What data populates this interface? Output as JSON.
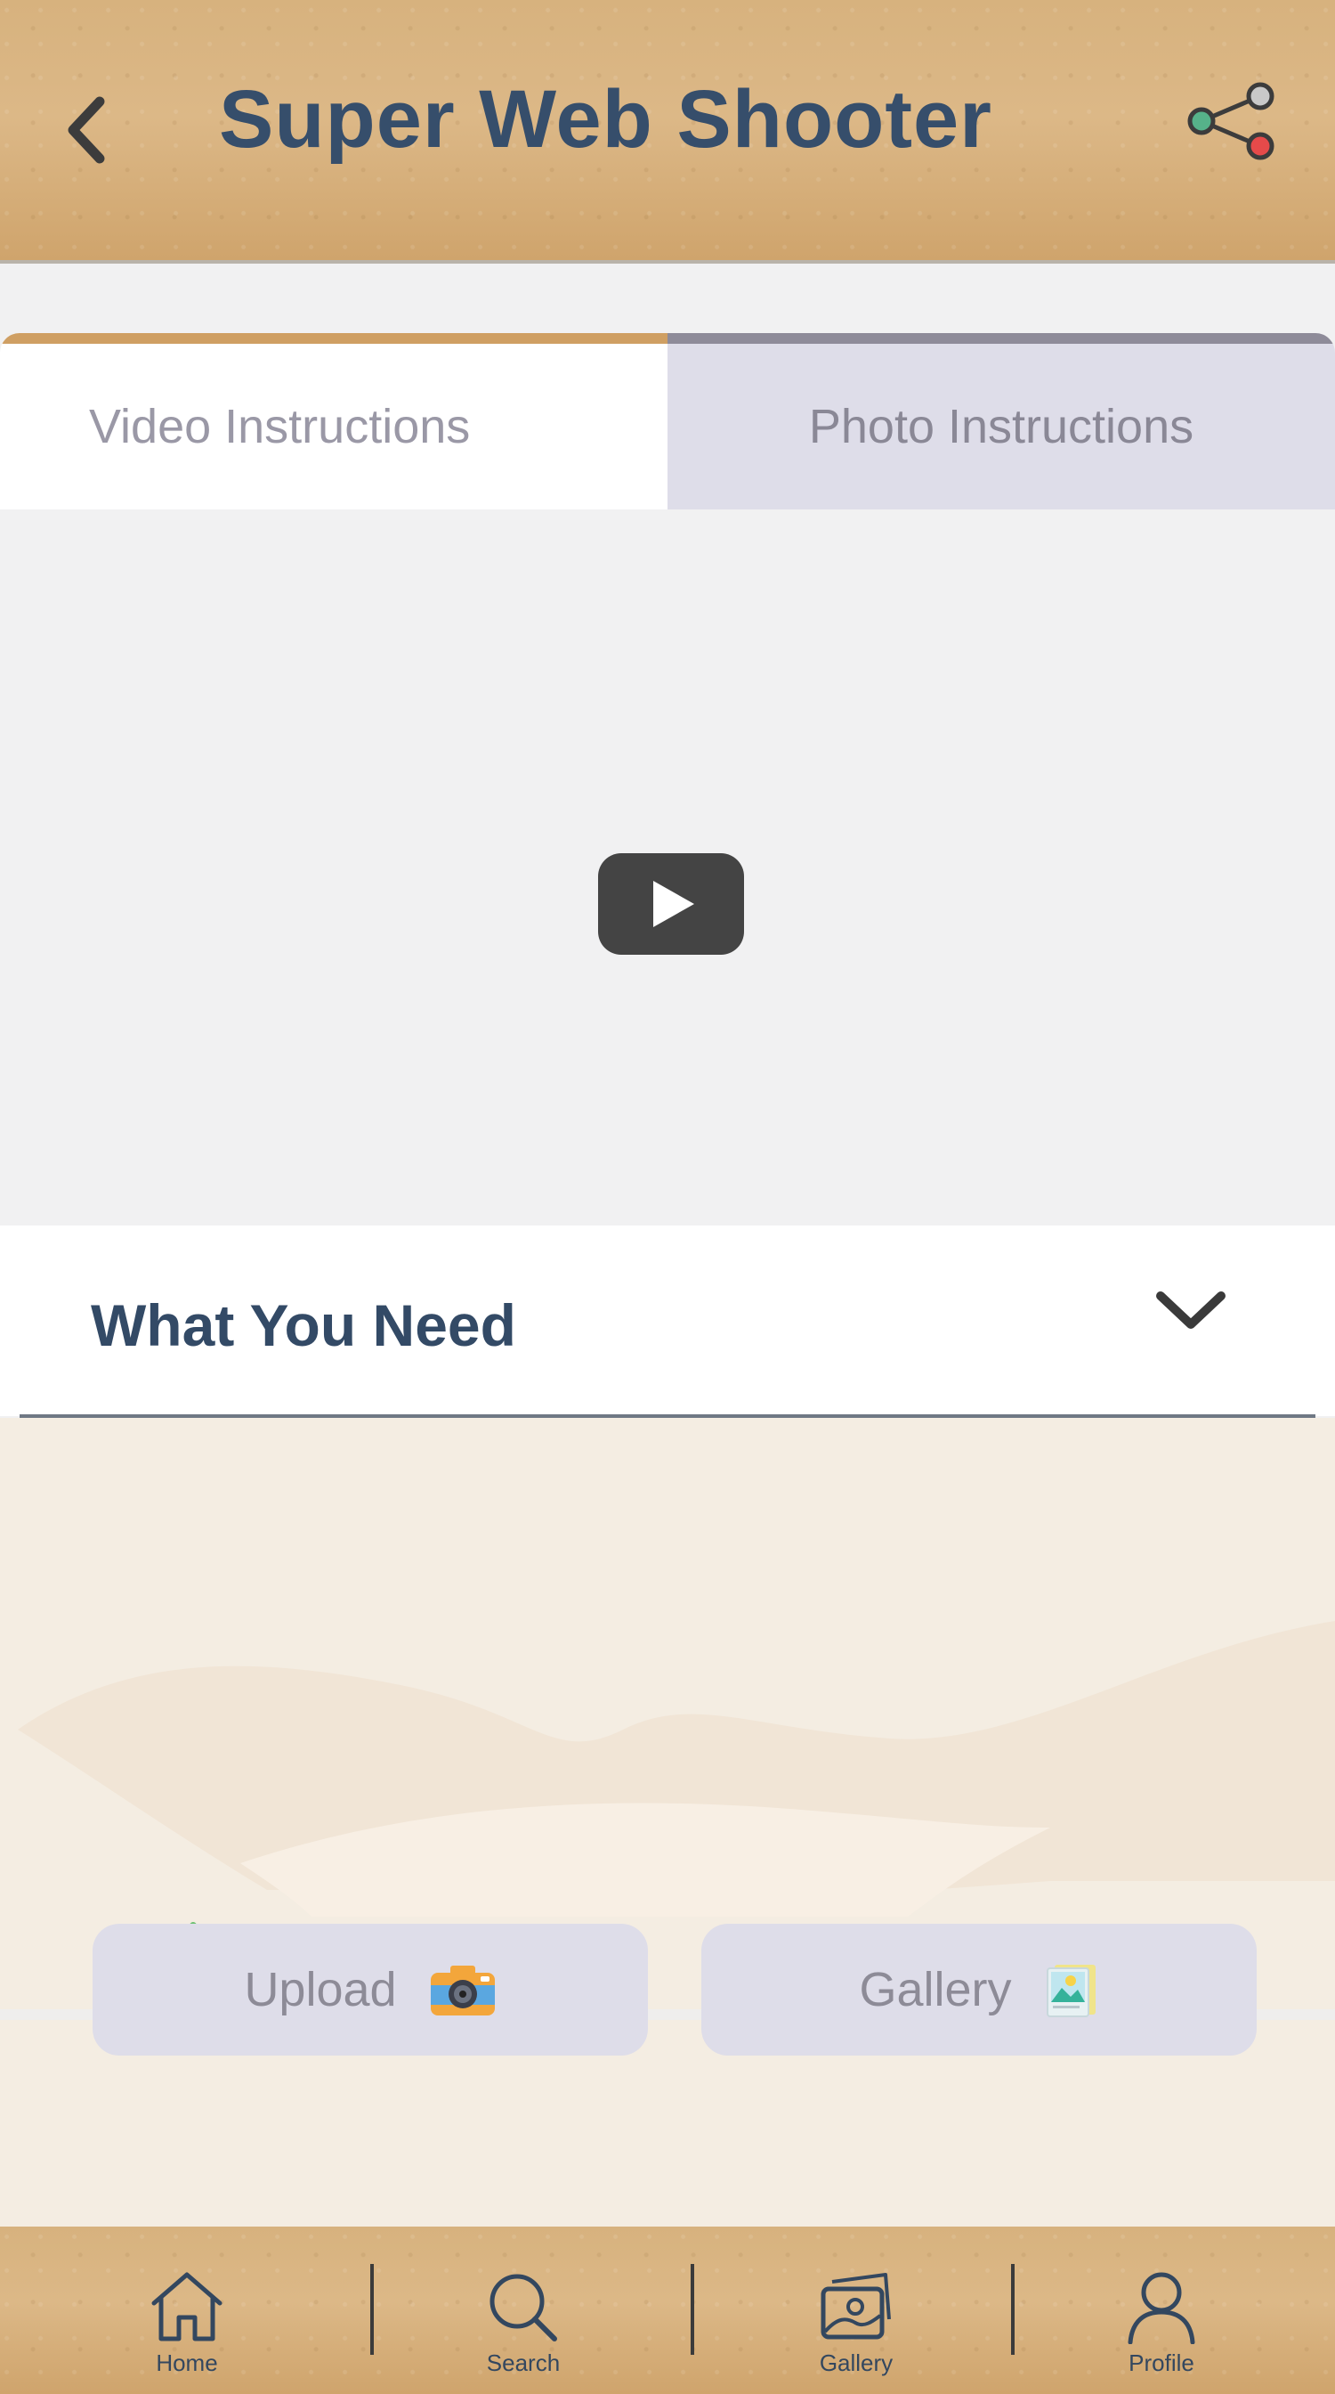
{
  "header": {
    "title": "Super Web Shooter",
    "back_icon": "chevron-left-icon",
    "share_icon": "share-icon"
  },
  "tabs": [
    {
      "label": "Video Instructions",
      "active": true
    },
    {
      "label": "Photo Instructions",
      "active": false
    }
  ],
  "video": {
    "play_icon": "play-button-icon"
  },
  "what_you_need": {
    "title": "What You Need",
    "expanded": false
  },
  "actions": {
    "upload_label": "Upload",
    "upload_icon": "camera-icon",
    "gallery_label": "Gallery",
    "gallery_icon": "picture-icon"
  },
  "nav": {
    "items": [
      {
        "label": "Home",
        "icon": "home-icon"
      },
      {
        "label": "Search",
        "icon": "search-icon"
      },
      {
        "label": "Gallery",
        "icon": "gallery-icon"
      },
      {
        "label": "Profile",
        "icon": "profile-icon"
      }
    ]
  },
  "colors": {
    "title": "#364e6b",
    "tab_active_accent": "#cf9f63",
    "tab_inactive_bg": "#dedde9",
    "button_bg": "#dedde9"
  }
}
